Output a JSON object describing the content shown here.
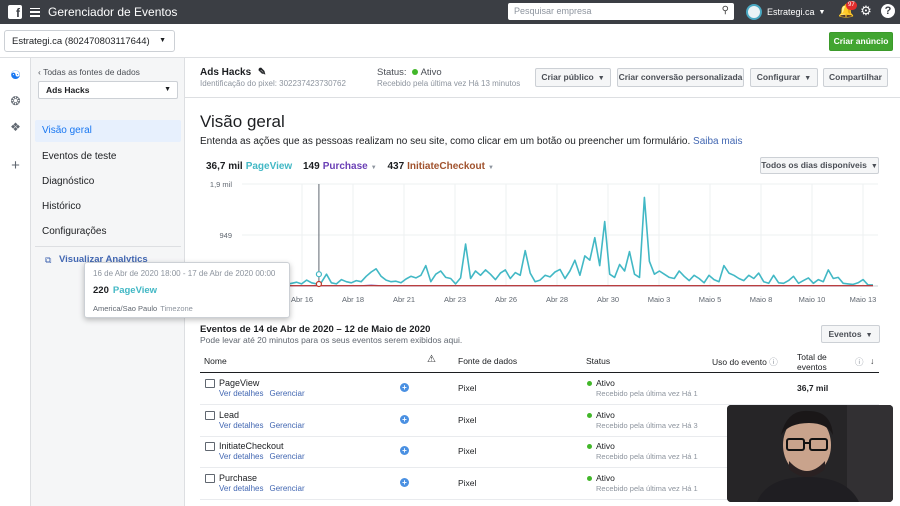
{
  "topbar": {
    "title": "Gerenciador de Eventos",
    "search_placeholder": "Pesquisar empresa",
    "account_name": "Estrategi.ca",
    "notifications_count": "97"
  },
  "account_bar": {
    "ad_account": "Estrategi.ca (802470803117644)",
    "create_ad_label": "Criar anúncio"
  },
  "sidebar": {
    "back_label": "Todas as fontes de dados",
    "pixel_select": "Ads Hacks",
    "items": [
      {
        "label": "Visão geral"
      },
      {
        "label": "Eventos de teste"
      },
      {
        "label": "Diagnóstico"
      },
      {
        "label": "Histórico"
      },
      {
        "label": "Configurações"
      }
    ],
    "analytics_link": "Visualizar Analytics"
  },
  "tooltip": {
    "date_range": "16 de Abr de 2020 18:00 - 17 de Abr de 2020 00:00",
    "value": "220",
    "event": "PageView",
    "timezone": "America/Sao Paulo",
    "timezone_label": "Timezone"
  },
  "pixel": {
    "name": "Ads Hacks",
    "id_label": "Identificação do pixel: 302237423730762",
    "status_label": "Status:",
    "status_value": "Ativo",
    "status_sub": "Recebido pela última vez Há 13 minutos"
  },
  "header_buttons": {
    "create_audience": "Criar público",
    "create_conversion": "Criar conversão personalizada",
    "configure": "Configurar",
    "share": "Compartilhar"
  },
  "overview": {
    "title": "Visão geral",
    "description": "Entenda as ações que as pessoas realizam no seu site, como clicar em um botão ou preencher um formulário.",
    "learn_more": "Saiba mais",
    "date_range_button": "Todos os dias disponíveis"
  },
  "metrics": [
    {
      "value": "36,7 mil",
      "event": "PageView"
    },
    {
      "value": "149",
      "event": "Purchase"
    },
    {
      "value": "437",
      "event": "InitiateCheckout"
    }
  ],
  "colors": {
    "pageview": "#42b8c5",
    "purchase": "#6a3fb5",
    "initiate_checkout": "#c0392b",
    "link": "#4267b2",
    "active_green": "#42b72a",
    "cta_green": "#42a531"
  },
  "chart_data": {
    "type": "line",
    "x_labels": [
      "Abr 16",
      "Abr 18",
      "Abr 21",
      "Abr 23",
      "Abr 26",
      "Abr 28",
      "Abr 30",
      "Maio 3",
      "Maio 5",
      "Maio 8",
      "Maio 10",
      "Maio 13"
    ],
    "y_ticks": [
      "1,9 mil",
      "949"
    ],
    "ylim": [
      0,
      1900
    ],
    "grid": true,
    "series": [
      {
        "name": "PageView",
        "values": [
          60,
          190,
          40,
          60,
          140,
          40,
          30,
          120,
          60,
          30,
          50,
          70,
          40,
          110,
          60,
          40,
          70,
          220,
          60,
          40,
          120,
          80,
          60,
          100,
          80,
          180,
          260,
          320,
          180,
          110,
          80,
          90,
          60,
          130,
          180,
          150,
          200,
          380,
          80,
          220,
          280,
          160,
          140,
          40,
          150,
          780,
          140,
          280,
          200,
          300,
          220,
          120,
          240,
          300,
          140,
          250,
          200,
          660,
          240,
          80,
          110,
          200,
          170,
          260,
          310,
          140,
          280,
          480,
          200,
          560,
          480,
          900,
          380,
          1200,
          220,
          160,
          400,
          280,
          640,
          220,
          160,
          1650,
          460,
          220,
          280,
          220,
          160,
          140,
          280,
          180,
          100,
          200,
          140,
          60,
          200,
          120,
          80,
          380,
          240,
          200,
          140,
          100,
          200,
          140,
          240,
          80,
          50,
          200,
          60,
          50,
          100,
          180,
          50,
          100,
          150,
          50,
          120,
          80,
          300,
          140,
          160,
          50,
          40,
          30,
          60,
          120,
          20,
          20
        ]
      },
      {
        "name": "Purchase",
        "values": [
          5,
          10,
          5,
          5,
          5,
          5,
          5,
          5,
          5,
          5,
          5,
          5,
          5,
          5,
          5,
          10,
          5,
          5,
          5,
          5,
          5,
          5,
          5,
          5,
          5,
          10,
          15,
          10,
          5,
          5,
          5,
          5,
          5,
          5,
          5,
          5,
          5,
          5,
          5,
          5,
          5,
          5,
          5,
          5,
          5,
          5,
          5,
          5,
          5,
          5,
          5,
          5,
          5,
          5,
          5,
          5,
          5,
          5,
          5,
          5,
          5,
          5,
          5,
          5,
          5,
          5,
          5,
          5,
          5,
          5,
          5,
          5,
          5,
          5,
          5,
          5,
          5,
          5,
          5,
          5,
          5,
          5,
          5,
          5,
          5,
          5,
          5,
          5,
          5,
          5,
          5,
          5,
          5,
          5,
          5,
          5,
          5,
          5,
          5,
          5,
          5,
          5,
          5,
          5,
          5,
          5,
          5,
          5,
          5,
          5,
          5,
          5,
          5,
          5,
          5,
          5,
          5,
          5,
          5,
          5,
          5,
          5,
          5,
          5,
          5,
          5,
          5,
          5
        ]
      },
      {
        "name": "InitiateCheckout",
        "values": [
          5,
          25,
          5,
          5,
          5,
          5,
          5,
          5,
          5,
          5,
          5,
          5,
          5,
          5,
          5,
          5,
          5,
          5,
          5,
          5,
          5,
          5,
          5,
          5,
          5,
          5,
          5,
          5,
          5,
          5,
          5,
          5,
          5,
          5,
          5,
          5,
          5,
          5,
          5,
          5,
          5,
          5,
          5,
          5,
          5,
          5,
          5,
          5,
          5,
          5,
          5,
          5,
          5,
          5,
          5,
          5,
          5,
          5,
          5,
          5,
          5,
          5,
          5,
          5,
          5,
          5,
          5,
          5,
          5,
          5,
          5,
          5,
          5,
          5,
          5,
          5,
          5,
          5,
          5,
          5,
          5,
          5,
          5,
          5,
          5,
          5,
          5,
          5,
          5,
          5,
          5,
          5,
          5,
          5,
          5,
          5,
          5,
          5,
          5,
          5,
          5,
          5,
          5,
          5,
          5,
          5,
          5,
          5,
          5,
          5,
          5,
          5,
          5,
          5,
          5,
          5,
          5,
          5,
          5,
          5,
          5,
          5,
          5,
          5,
          5,
          5,
          5,
          5
        ]
      }
    ],
    "hover_index": 3
  },
  "events_section": {
    "title": "Eventos de 14 de Abr de 2020 – 12 de Maio de 2020",
    "subtitle": "Pode levar até 20 minutos para os seus eventos serem exibidos aqui.",
    "filter_button": "Eventos",
    "columns": {
      "name": "Nome",
      "source": "Fonte de dados",
      "status": "Status",
      "usage": "Uso do evento",
      "total": "Total de eventos"
    },
    "view_details": "Ver detalhes",
    "manage": "Gerenciar",
    "rows": [
      {
        "name": "PageView",
        "source": "Pixel",
        "status": "Ativo",
        "status_sub": "Recebido pela última vez Há 1",
        "total": "36,7 mil",
        "icon": "page-icon"
      },
      {
        "name": "Lead",
        "source": "Pixel",
        "status": "Ativo",
        "status_sub": "Recebido pela última vez Há 3",
        "total": "",
        "icon": "lead-icon"
      },
      {
        "name": "InitiateCheckout",
        "source": "Pixel",
        "status": "Ativo",
        "status_sub": "Recebido pela última vez Há 1",
        "total": "",
        "icon": "checkout-icon"
      },
      {
        "name": "Purchase",
        "source": "Pixel",
        "status": "Ativo",
        "status_sub": "Recebido pela última vez Há 1",
        "total": "",
        "icon": "cart-icon"
      }
    ]
  }
}
